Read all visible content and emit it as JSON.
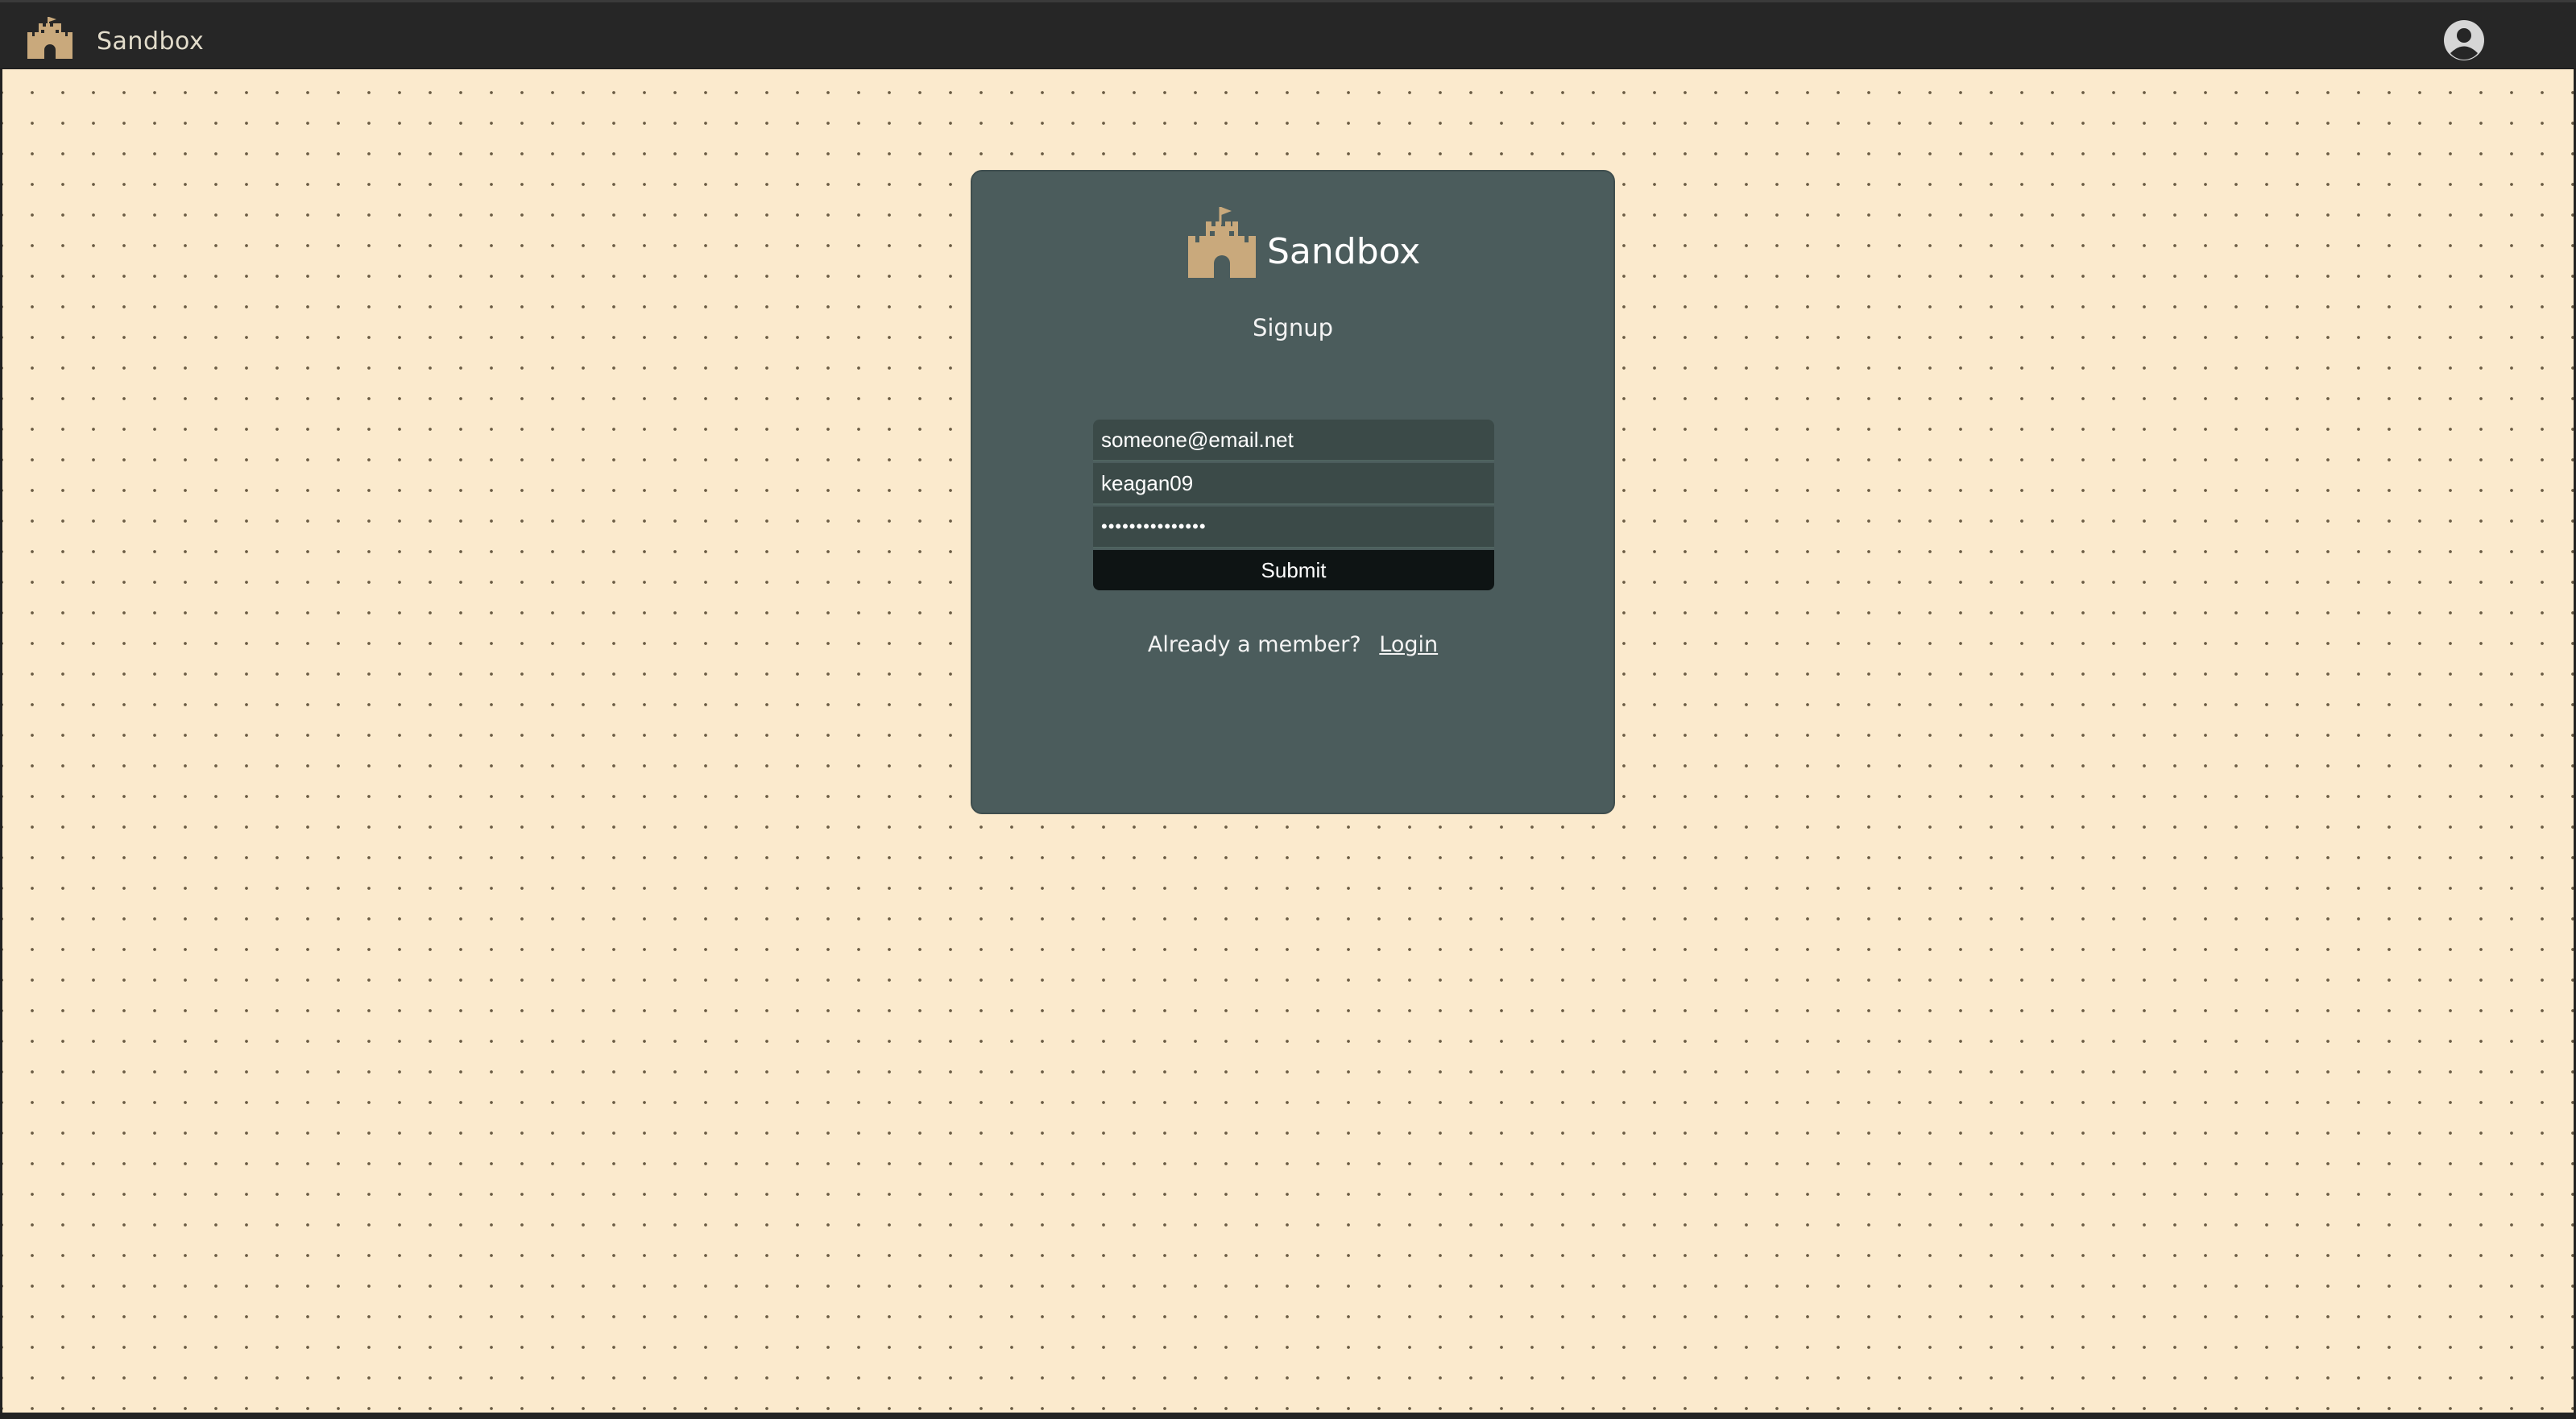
{
  "topbar": {
    "brand_icon": "castle-icon",
    "brand_name": "Sandbox",
    "account_icon": "user-circle-icon"
  },
  "card": {
    "logo_icon": "castle-icon",
    "title": "Sandbox",
    "subtitle": "Signup",
    "email_value": "someone@email.net",
    "username_value": "keagan09",
    "password_value": "•••••••••••••••",
    "submit_label": "Submit",
    "member_text": "Already a member?",
    "login_label": "Login"
  },
  "colors": {
    "topbar_bg": "#262626",
    "canvas_bg": "#fbeacd",
    "card_bg": "#4b5c5c",
    "icon_tan": "#c9a97c",
    "submit_bg": "#0e1414"
  }
}
